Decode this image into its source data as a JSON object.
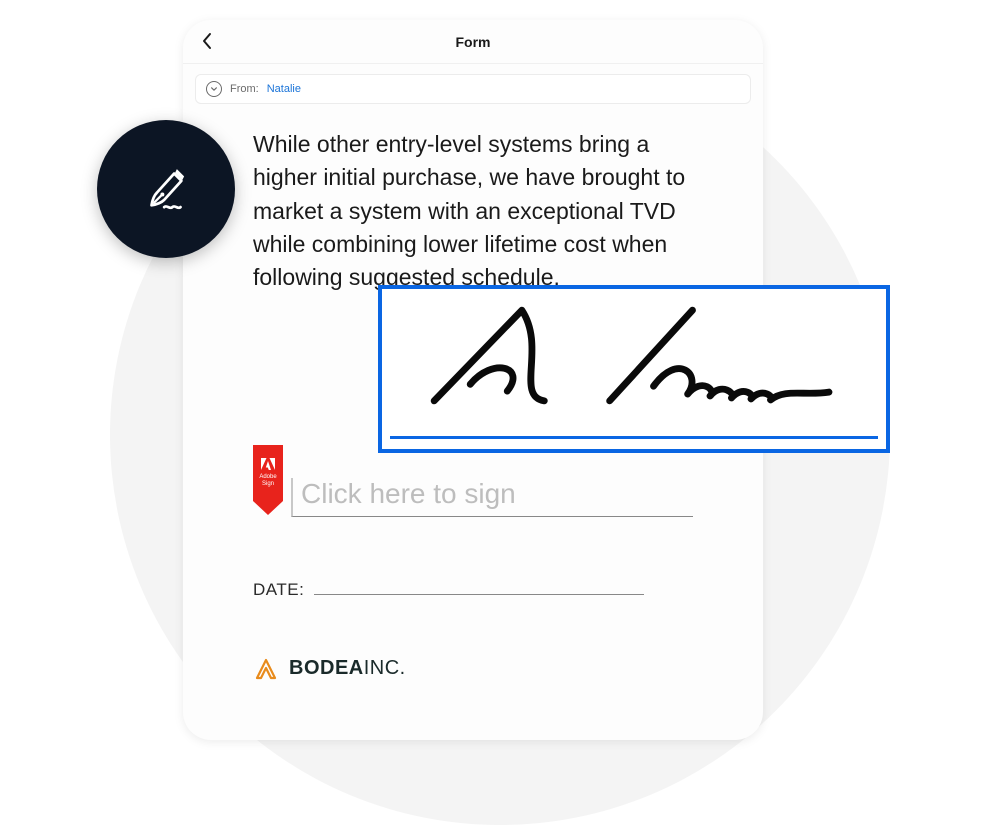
{
  "header": {
    "title": "Form"
  },
  "from": {
    "label": "From:",
    "name": "Natalie"
  },
  "document": {
    "paragraph": "While other entry-level systems bring a higher initial purchase, we have brought to market a system with an exceptional TVD while combining lower lifetime cost when following suggested schedule."
  },
  "signature": {
    "placeholder": "Click here to sign",
    "flag_brand": "Adobe",
    "flag_product": "Sign"
  },
  "date": {
    "label": "DATE:"
  },
  "company": {
    "name_bold": "BODEA",
    "name_light": "INC."
  },
  "colors": {
    "accent_blue": "#0a66e3",
    "adobe_red": "#e8231c",
    "badge_dark": "#0c1524",
    "bg_circle": "#f4f4f4"
  }
}
